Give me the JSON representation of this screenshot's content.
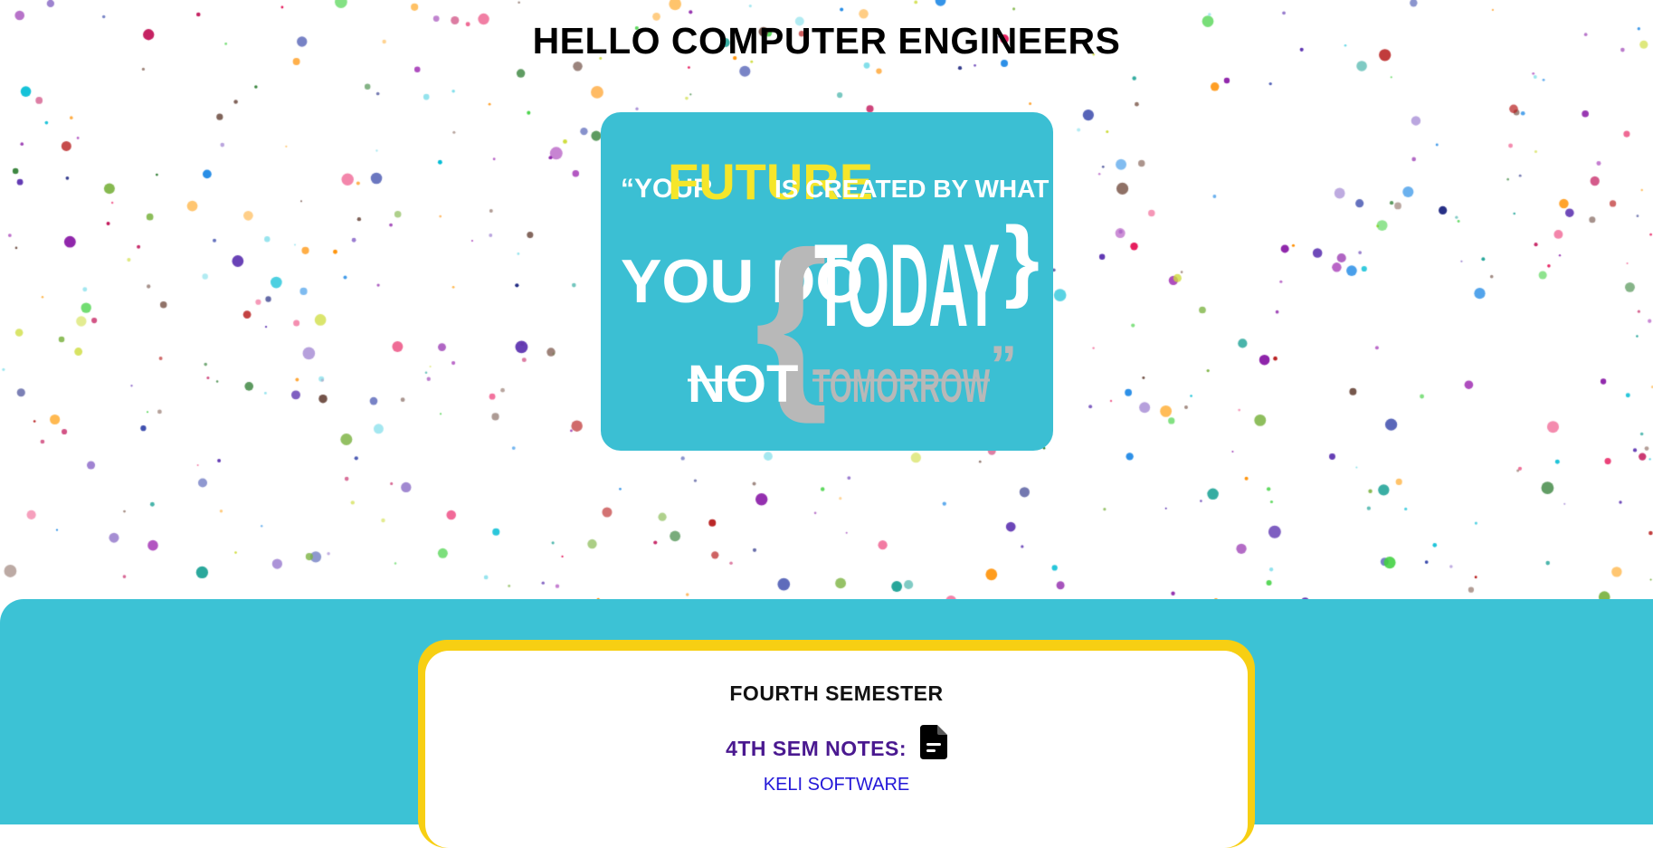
{
  "header": {
    "title": "HELLO COMPUTER ENGINEERS"
  },
  "hero": {
    "quote_open": "“YOUR",
    "quote_future": "FUTURE",
    "quote_created": "IS CREATED BY WHAT",
    "quote_you_do": "YOU DO",
    "brace_open": "{",
    "quote_today": "TODAY",
    "brace_close": "}",
    "quote_not": "NOT",
    "quote_tomorrow": "TOMORROW",
    "quote_close": "”",
    "colors": {
      "background": "#3bbfd3",
      "highlight": "#f5e62a",
      "text": "#ffffff",
      "muted": "#b8b8b8"
    }
  },
  "semester": {
    "title": "FOURTH SEMESTER",
    "notes_label": "4TH SEM NOTES:",
    "notes_icon": "document-icon",
    "link_label": "KELI SOFTWARE"
  },
  "theme": {
    "band": "#3cc2d5",
    "card_border": "#f7cf13",
    "notes_color": "#4a1990",
    "link_color": "#2317d8"
  }
}
